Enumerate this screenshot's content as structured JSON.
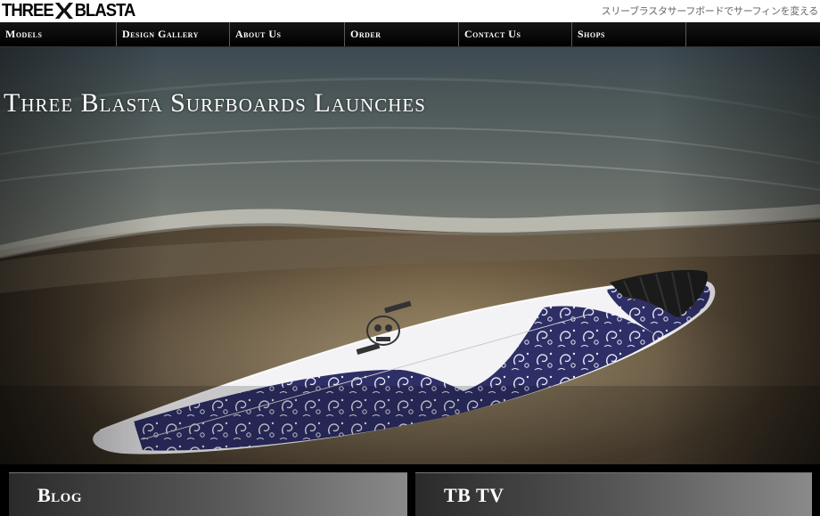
{
  "header": {
    "logo_left": "THREE",
    "logo_right": "BLASTA",
    "tagline": "スリーブラスタサーフボードでサーフィンを変える"
  },
  "nav": {
    "items": [
      {
        "label": "Models"
      },
      {
        "label": "Design Gallery"
      },
      {
        "label": "About Us"
      },
      {
        "label": "Order"
      },
      {
        "label": "Contact Us"
      },
      {
        "label": "Shops"
      }
    ]
  },
  "hero": {
    "title": "Three Blasta Surfboards Launches",
    "image": "surfboard-on-beach-photo"
  },
  "boxes": {
    "blog_label": "Blog",
    "tbtv_label": "TB TV"
  },
  "colors": {
    "nav_bg": "#000000",
    "box_gradient_dark": "#2a2a2a",
    "box_gradient_light": "#8a8a8a",
    "paisley": "#2e2f66"
  }
}
